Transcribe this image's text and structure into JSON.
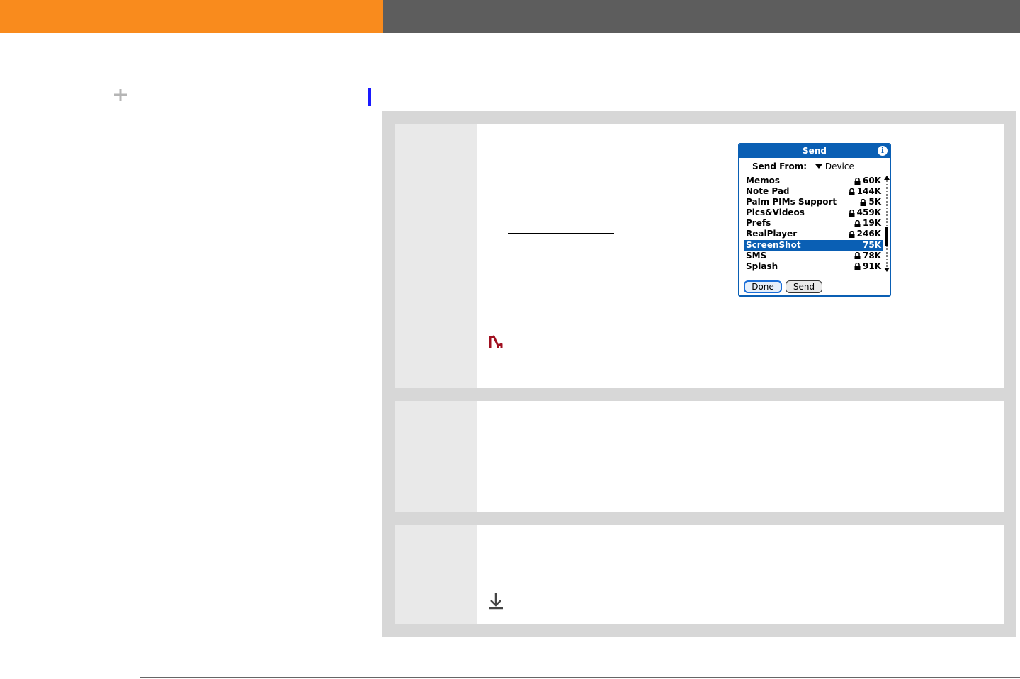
{
  "palm_dialog": {
    "title": "Send",
    "info_label": "i",
    "send_from_label": "Send From:",
    "send_from_value": "Device",
    "apps": [
      {
        "name": "Memos",
        "size": "60K",
        "locked": true,
        "selected": false
      },
      {
        "name": "Note Pad",
        "size": "144K",
        "locked": true,
        "selected": false
      },
      {
        "name": "Palm PIMs Support",
        "size": "5K",
        "locked": true,
        "selected": false
      },
      {
        "name": "Pics&Videos",
        "size": "459K",
        "locked": true,
        "selected": false
      },
      {
        "name": "Prefs",
        "size": "19K",
        "locked": true,
        "selected": false
      },
      {
        "name": "RealPlayer",
        "size": "246K",
        "locked": true,
        "selected": false
      },
      {
        "name": "ScreenShot",
        "size": "75K",
        "locked": false,
        "selected": true
      },
      {
        "name": "SMS",
        "size": "78K",
        "locked": true,
        "selected": false
      },
      {
        "name": "Splash",
        "size": "91K",
        "locked": true,
        "selected": false
      }
    ],
    "done_label": "Done",
    "send_label": "Send"
  },
  "colors": {
    "orange": "#f98b1d",
    "dark_gray": "#5d5d5d",
    "palm_blue": "#0a5fb4",
    "marker_blue": "#1a1aff",
    "note_red": "#a01020"
  },
  "icons": {
    "plus": "plus-icon",
    "note": "tip-note-icon",
    "download": "download-arrow-icon",
    "lock": "lock-icon"
  }
}
